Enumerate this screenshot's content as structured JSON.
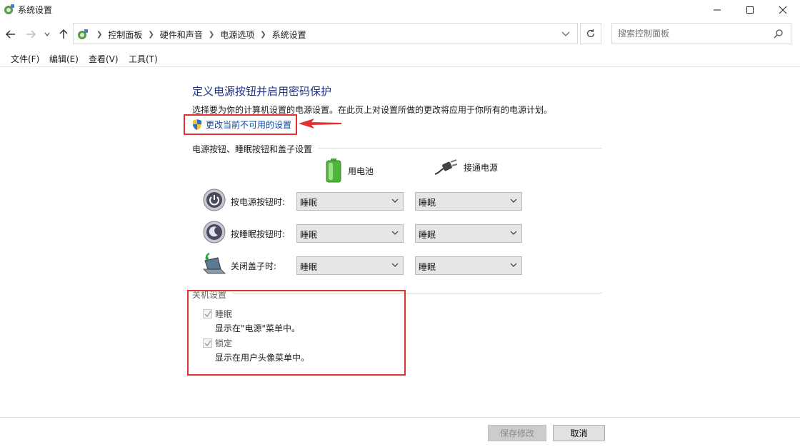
{
  "window": {
    "title": "系统设置"
  },
  "breadcrumbs": [
    "控制面板",
    "硬件和声音",
    "电源选项",
    "系统设置"
  ],
  "search": {
    "placeholder": "搜索控制面板"
  },
  "menu": [
    "文件(F)",
    "编辑(E)",
    "查看(V)",
    "工具(T)"
  ],
  "main": {
    "heading": "定义电源按钮并启用密码保护",
    "description": "选择要为你的计算机设置的电源设置。在此页上对设置所做的更改将应用于你所有的电源计划。",
    "change_link": "更改当前不可用的设置",
    "group_title": "电源按钮、睡眠按钮和盖子设置",
    "columns": {
      "battery": "用电池",
      "plugged": "接通电源"
    },
    "rows": [
      {
        "label": "按电源按钮时:",
        "battery": "睡眠",
        "plugged": "睡眠",
        "icon": "power-button-icon"
      },
      {
        "label": "按睡眠按钮时:",
        "battery": "睡眠",
        "plugged": "睡眠",
        "icon": "sleep-button-icon"
      },
      {
        "label": "关闭盖子时:",
        "battery": "睡眠",
        "plugged": "睡眠",
        "icon": "laptop-lid-icon"
      }
    ],
    "shutdown": {
      "title": "关机设置",
      "items": [
        {
          "label": "睡眠",
          "desc": "显示在\"电源\"菜单中。",
          "checked": true
        },
        {
          "label": "锁定",
          "desc": "显示在用户头像菜单中。",
          "checked": true
        }
      ]
    }
  },
  "footer": {
    "save": "保存修改",
    "cancel": "取消"
  },
  "colors": {
    "accent_heading": "#1e3287",
    "link": "#0c47a8",
    "annotation_red": "#e03030"
  }
}
